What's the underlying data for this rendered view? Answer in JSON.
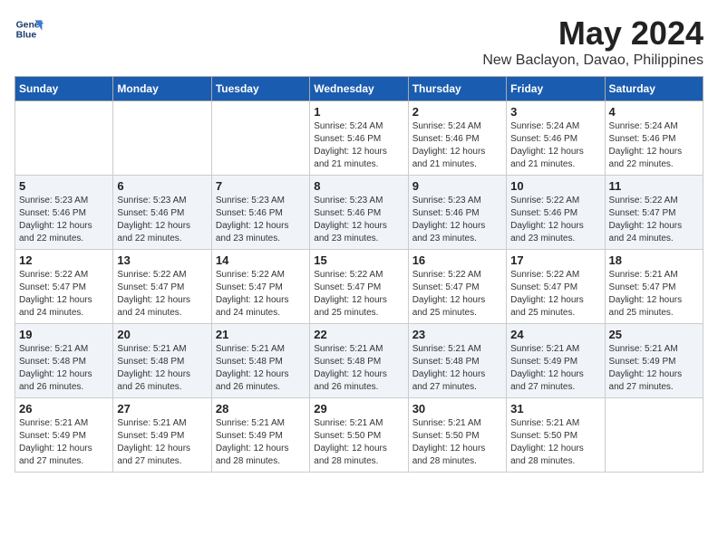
{
  "header": {
    "logo_line1": "General",
    "logo_line2": "Blue",
    "month": "May 2024",
    "location": "New Baclayon, Davao, Philippines"
  },
  "weekdays": [
    "Sunday",
    "Monday",
    "Tuesday",
    "Wednesday",
    "Thursday",
    "Friday",
    "Saturday"
  ],
  "weeks": [
    [
      {
        "day": "",
        "info": ""
      },
      {
        "day": "",
        "info": ""
      },
      {
        "day": "",
        "info": ""
      },
      {
        "day": "1",
        "info": "Sunrise: 5:24 AM\nSunset: 5:46 PM\nDaylight: 12 hours\nand 21 minutes."
      },
      {
        "day": "2",
        "info": "Sunrise: 5:24 AM\nSunset: 5:46 PM\nDaylight: 12 hours\nand 21 minutes."
      },
      {
        "day": "3",
        "info": "Sunrise: 5:24 AM\nSunset: 5:46 PM\nDaylight: 12 hours\nand 21 minutes."
      },
      {
        "day": "4",
        "info": "Sunrise: 5:24 AM\nSunset: 5:46 PM\nDaylight: 12 hours\nand 22 minutes."
      }
    ],
    [
      {
        "day": "5",
        "info": "Sunrise: 5:23 AM\nSunset: 5:46 PM\nDaylight: 12 hours\nand 22 minutes."
      },
      {
        "day": "6",
        "info": "Sunrise: 5:23 AM\nSunset: 5:46 PM\nDaylight: 12 hours\nand 22 minutes."
      },
      {
        "day": "7",
        "info": "Sunrise: 5:23 AM\nSunset: 5:46 PM\nDaylight: 12 hours\nand 23 minutes."
      },
      {
        "day": "8",
        "info": "Sunrise: 5:23 AM\nSunset: 5:46 PM\nDaylight: 12 hours\nand 23 minutes."
      },
      {
        "day": "9",
        "info": "Sunrise: 5:23 AM\nSunset: 5:46 PM\nDaylight: 12 hours\nand 23 minutes."
      },
      {
        "day": "10",
        "info": "Sunrise: 5:22 AM\nSunset: 5:46 PM\nDaylight: 12 hours\nand 23 minutes."
      },
      {
        "day": "11",
        "info": "Sunrise: 5:22 AM\nSunset: 5:47 PM\nDaylight: 12 hours\nand 24 minutes."
      }
    ],
    [
      {
        "day": "12",
        "info": "Sunrise: 5:22 AM\nSunset: 5:47 PM\nDaylight: 12 hours\nand 24 minutes."
      },
      {
        "day": "13",
        "info": "Sunrise: 5:22 AM\nSunset: 5:47 PM\nDaylight: 12 hours\nand 24 minutes."
      },
      {
        "day": "14",
        "info": "Sunrise: 5:22 AM\nSunset: 5:47 PM\nDaylight: 12 hours\nand 24 minutes."
      },
      {
        "day": "15",
        "info": "Sunrise: 5:22 AM\nSunset: 5:47 PM\nDaylight: 12 hours\nand 25 minutes."
      },
      {
        "day": "16",
        "info": "Sunrise: 5:22 AM\nSunset: 5:47 PM\nDaylight: 12 hours\nand 25 minutes."
      },
      {
        "day": "17",
        "info": "Sunrise: 5:22 AM\nSunset: 5:47 PM\nDaylight: 12 hours\nand 25 minutes."
      },
      {
        "day": "18",
        "info": "Sunrise: 5:21 AM\nSunset: 5:47 PM\nDaylight: 12 hours\nand 25 minutes."
      }
    ],
    [
      {
        "day": "19",
        "info": "Sunrise: 5:21 AM\nSunset: 5:48 PM\nDaylight: 12 hours\nand 26 minutes."
      },
      {
        "day": "20",
        "info": "Sunrise: 5:21 AM\nSunset: 5:48 PM\nDaylight: 12 hours\nand 26 minutes."
      },
      {
        "day": "21",
        "info": "Sunrise: 5:21 AM\nSunset: 5:48 PM\nDaylight: 12 hours\nand 26 minutes."
      },
      {
        "day": "22",
        "info": "Sunrise: 5:21 AM\nSunset: 5:48 PM\nDaylight: 12 hours\nand 26 minutes."
      },
      {
        "day": "23",
        "info": "Sunrise: 5:21 AM\nSunset: 5:48 PM\nDaylight: 12 hours\nand 27 minutes."
      },
      {
        "day": "24",
        "info": "Sunrise: 5:21 AM\nSunset: 5:49 PM\nDaylight: 12 hours\nand 27 minutes."
      },
      {
        "day": "25",
        "info": "Sunrise: 5:21 AM\nSunset: 5:49 PM\nDaylight: 12 hours\nand 27 minutes."
      }
    ],
    [
      {
        "day": "26",
        "info": "Sunrise: 5:21 AM\nSunset: 5:49 PM\nDaylight: 12 hours\nand 27 minutes."
      },
      {
        "day": "27",
        "info": "Sunrise: 5:21 AM\nSunset: 5:49 PM\nDaylight: 12 hours\nand 27 minutes."
      },
      {
        "day": "28",
        "info": "Sunrise: 5:21 AM\nSunset: 5:49 PM\nDaylight: 12 hours\nand 28 minutes."
      },
      {
        "day": "29",
        "info": "Sunrise: 5:21 AM\nSunset: 5:50 PM\nDaylight: 12 hours\nand 28 minutes."
      },
      {
        "day": "30",
        "info": "Sunrise: 5:21 AM\nSunset: 5:50 PM\nDaylight: 12 hours\nand 28 minutes."
      },
      {
        "day": "31",
        "info": "Sunrise: 5:21 AM\nSunset: 5:50 PM\nDaylight: 12 hours\nand 28 minutes."
      },
      {
        "day": "",
        "info": ""
      }
    ]
  ]
}
